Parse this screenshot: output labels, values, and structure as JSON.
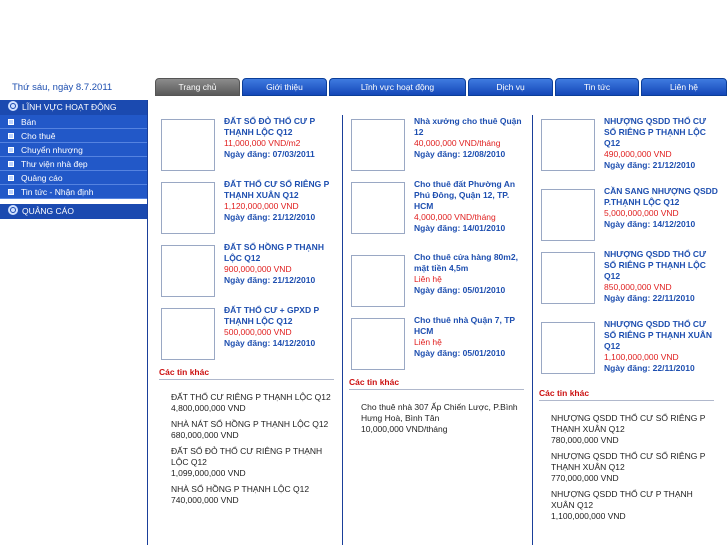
{
  "header": {
    "date": "Thứ sáu, ngày 8.7.2011"
  },
  "nav": [
    {
      "label": "Trang chủ",
      "active": true
    },
    {
      "label": "Giới thiệu"
    },
    {
      "label": "Lĩnh vực hoạt động"
    },
    {
      "label": "Dịch vụ"
    },
    {
      "label": "Tin tức"
    },
    {
      "label": "Liên hệ"
    }
  ],
  "sidebar": {
    "heading": "LĨNH VỰC HOẠT ĐỘNG",
    "items": [
      "Bán",
      "Cho thuê",
      "Chuyển nhượng",
      "Thư viện nhà đẹp",
      "Quảng cáo",
      "Tin tức - Nhận định"
    ],
    "ads_heading": "QUẢNG CÁO"
  },
  "columns": [
    {
      "listings": [
        {
          "title": "ĐẤT SỔ ĐỎ THỔ CƯ P THẠNH LỘC Q12",
          "price": "11,000,000 VND/m2",
          "date": "Ngày đăng: 07/03/2011"
        },
        {
          "title": "ĐẤT THỔ CƯ SỔ RIÊNG P THẠNH XUÂN Q12",
          "price": "1,120,000,000 VND",
          "date": "Ngày đăng: 21/12/2010"
        },
        {
          "title": "ĐẤT SỔ HỒNG P THẠNH LỘC Q12",
          "price": "900,000,000 VND",
          "date": "Ngày đăng: 21/12/2010"
        },
        {
          "title": "ĐẤT THỔ CƯ + GPXD P THẠNH LỘC Q12",
          "price": "500,000,000 VND",
          "date": "Ngày đăng: 14/12/2010"
        }
      ],
      "more_heading": "Các tin khác",
      "more": [
        {
          "title": "ĐẤT THỔ CƯ RIÊNG P THẠNH LỘC Q12",
          "price": "4,800,000,000 VND"
        },
        {
          "title": "NHÀ NÁT SỔ HỒNG P THẠNH LỘC Q12",
          "price": "680,000,000 VND"
        },
        {
          "title": "ĐẤT SỔ ĐỎ THỔ CƯ RIÊNG P THẠNH LỘC Q12",
          "price": "1,099,000,000 VND"
        },
        {
          "title": "NHÀ SỔ HỒNG P THẠNH LỘC Q12",
          "price": "740,000,000 VND"
        }
      ]
    },
    {
      "listings": [
        {
          "title": "Nhà xưởng cho thuê Quận 12",
          "price": "40,000,000 VND/tháng",
          "date": "Ngày đăng: 12/08/2010"
        },
        {
          "title": "Cho thuê đất Phường An Phú Đông, Quận 12, TP. HCM",
          "price": "4,000,000 VND/tháng",
          "date": "Ngày đăng: 14/01/2010"
        },
        {
          "title": "Cho thuê cửa hàng 80m2, mặt tiền 4,5m",
          "price": "Liên hệ",
          "date": "Ngày đăng: 05/01/2010"
        },
        {
          "title": "Cho thuê nhà Quận 7, TP HCM",
          "price": "Liên hệ",
          "date": "Ngày đăng: 05/01/2010"
        }
      ],
      "more_heading": "Các tin khác",
      "more": [
        {
          "title": "Cho thuê nhà 307 Ấp Chiến Lược, P.Bình Hưng Hoà, Bình Tân",
          "price": "10,000,000 VND/tháng"
        }
      ]
    },
    {
      "listings": [
        {
          "title": "NHƯỢNG QSDD THỔ CƯ SỔ RIÊNG P THẠNH LỘC Q12",
          "price": "490,000,000 VND",
          "date": "Ngày đăng: 21/12/2010"
        },
        {
          "title": "CẦN SANG NHƯỢNG QSDD P.THẠNH LỘC Q12",
          "price": "5,000,000,000 VND",
          "date": "Ngày đăng: 14/12/2010"
        },
        {
          "title": "NHƯỢNG QSDD THỔ CƯ SỔ RIÊNG P THẠNH LỘC Q12",
          "price": "850,000,000 VND",
          "date": "Ngày đăng: 22/11/2010"
        },
        {
          "title": "NHƯỢNG QSDD THỔ CƯ SỔ RIÊNG P THẠNH XUÂN Q12",
          "price": "1,100,000,000 VND",
          "date": "Ngày đăng: 22/11/2010"
        }
      ],
      "more_heading": "Các tin khác",
      "more": [
        {
          "title": "NHƯỢNG QSDD THỔ CƯ SỔ RIÊNG P THẠNH XUÂN Q12",
          "price": "780,000,000 VND"
        },
        {
          "title": "NHƯỢNG QSDD THỔ CƯ SỔ RIÊNG P THẠNH XUÂN Q12",
          "price": "770,000,000 VND"
        },
        {
          "title": "NHƯỢNG QSDD THỔ CƯ P THẠNH XUÂN Q12",
          "price": "1,100,000,000 VND"
        }
      ]
    }
  ]
}
